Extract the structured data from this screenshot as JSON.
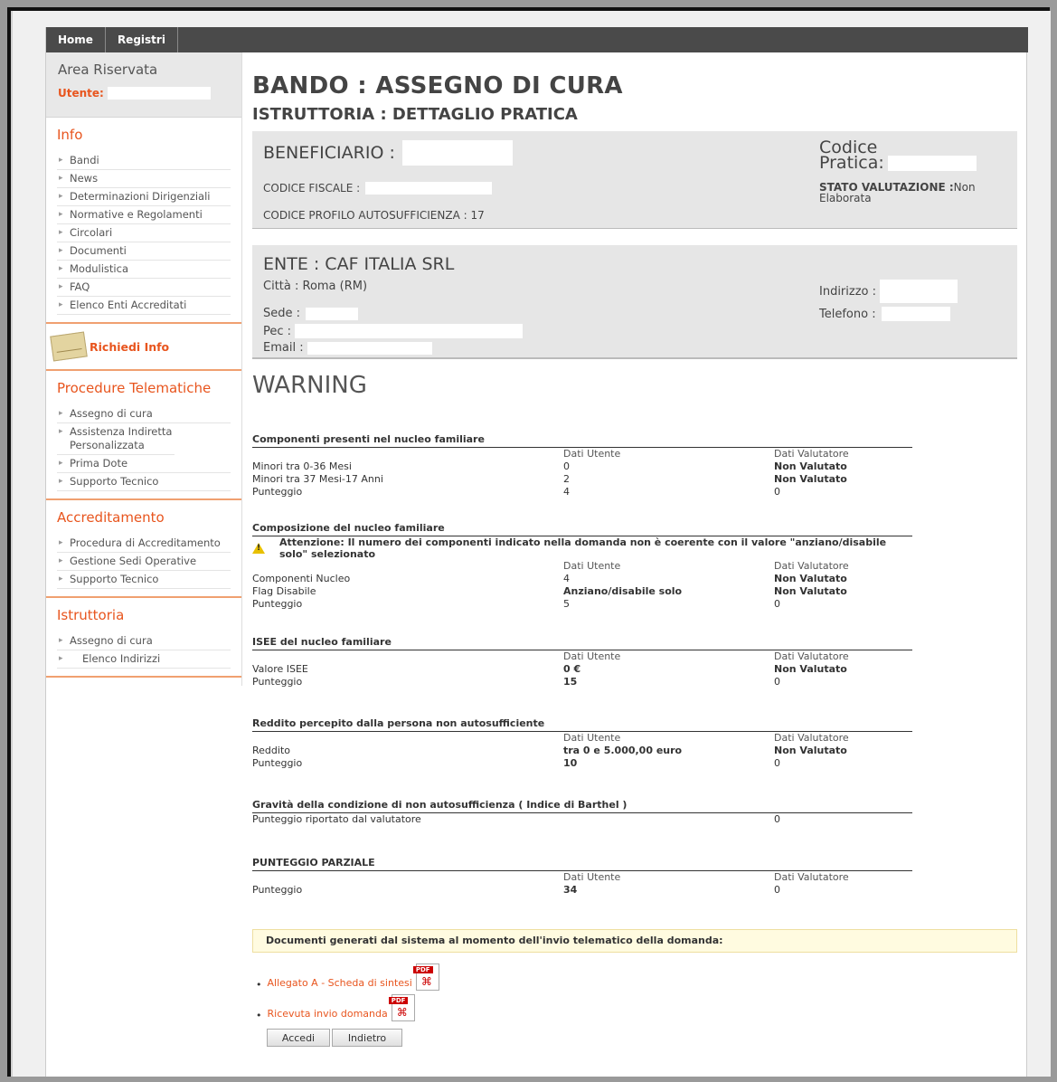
{
  "nav": {
    "home": "Home",
    "registri": "Registri"
  },
  "sidebar": {
    "area_title": "Area Riservata",
    "user_label": "Utente:",
    "info": {
      "title": "Info",
      "items": [
        "Bandi",
        "News",
        "Determinazioni Dirigenziali",
        "Normative e Regolamenti",
        "Circolari",
        "Documenti",
        "Modulistica",
        "FAQ",
        "Elenco Enti Accreditati"
      ]
    },
    "richiedi": "Richiedi Info",
    "procedure": {
      "title": "Procedure Telematiche",
      "items": [
        "Assegno di cura",
        "Assistenza Indiretta Personalizzata",
        "Prima Dote",
        "Supporto Tecnico"
      ]
    },
    "accreditamento": {
      "title": "Accreditamento",
      "items": [
        "Procedura di Accreditamento",
        "Gestione Sedi Operative",
        "Supporto Tecnico"
      ]
    },
    "istruttoria": {
      "title": "Istruttoria",
      "items": [
        "Assegno di cura",
        "Elenco Indirizzi"
      ]
    }
  },
  "main": {
    "title": "BANDO : ASSEGNO DI CURA",
    "subtitle": "ISTRUTTORIA : DETTAGLIO PRATICA",
    "beneficiario": {
      "label": "BENEFICIARIO :",
      "cf_label": "CODICE FISCALE :",
      "profilo": "CODICE PROFILO AUTOSUFFICIENZA : 17",
      "codice_pratica_1": "Codice",
      "codice_pratica_2": "Pratica:",
      "stato_label": "STATO VALUTAZIONE :",
      "stato_value_1": "Non",
      "stato_value_2": "Elaborata"
    },
    "ente": {
      "title": "ENTE : CAF ITALIA SRL",
      "citta": "Città : Roma (RM)",
      "sede": "Sede :",
      "pec": "Pec :",
      "email": "Email :",
      "indirizzo": "Indirizzo :",
      "telefono": "Telefono :"
    },
    "warning": "WARNING",
    "col_user": "Dati Utente",
    "col_eval": "Dati Valutatore",
    "sections": {
      "componenti": {
        "head": "Componenti presenti nel nucleo familiare",
        "rows": [
          {
            "label": "Minori tra 0-36 Mesi",
            "user": "0",
            "eval": "Non Valutato"
          },
          {
            "label": "Minori tra 37 Mesi-17 Anni",
            "user": "2",
            "eval": "Non Valutato"
          },
          {
            "label": "Punteggio",
            "user": "4",
            "eval": "0"
          }
        ]
      },
      "composizione": {
        "head": "Composizione del nucleo familiare",
        "alert": "Attenzione: Il numero dei componenti indicato nella domanda non è coerente con il valore \"anziano/disabile solo\" selezionato",
        "rows": [
          {
            "label": "Componenti Nucleo",
            "user": "4",
            "eval": "Non Valutato"
          },
          {
            "label": "Flag Disabile",
            "user": "Anziano/disabile solo",
            "eval": "Non Valutato"
          },
          {
            "label": "Punteggio",
            "user": "5",
            "eval": "0"
          }
        ]
      },
      "isee": {
        "head": "ISEE del nucleo familiare",
        "rows": [
          {
            "label": "Valore ISEE",
            "user": "0 €",
            "eval": "Non Valutato"
          },
          {
            "label": "Punteggio",
            "user": "15",
            "eval": "0"
          }
        ]
      },
      "reddito": {
        "head": "Reddito percepito dalla persona non autosufficiente",
        "rows": [
          {
            "label": "Reddito",
            "user": "tra 0 e 5.000,00 euro",
            "eval": "Non Valutato"
          },
          {
            "label": "Punteggio",
            "user": "10",
            "eval": "0"
          }
        ]
      },
      "gravita": {
        "head": "Gravità della condizione di non autosufficienza ( Indice di Barthel )",
        "label": "Punteggio riportato dal valutatore",
        "eval": "0"
      },
      "parziale": {
        "head": "PUNTEGGIO PARZIALE",
        "label": "Punteggio",
        "user": "34",
        "eval": "0"
      }
    },
    "docs_note": "Documenti generati dal sistema al momento dell'invio telematico della domanda:",
    "doc1": "Allegato A - Scheda di sintesi",
    "doc2": "Ricevuta invio domanda",
    "pdf_tag": "PDF",
    "btn_accedi": "Accedi",
    "btn_indietro": "Indietro"
  }
}
